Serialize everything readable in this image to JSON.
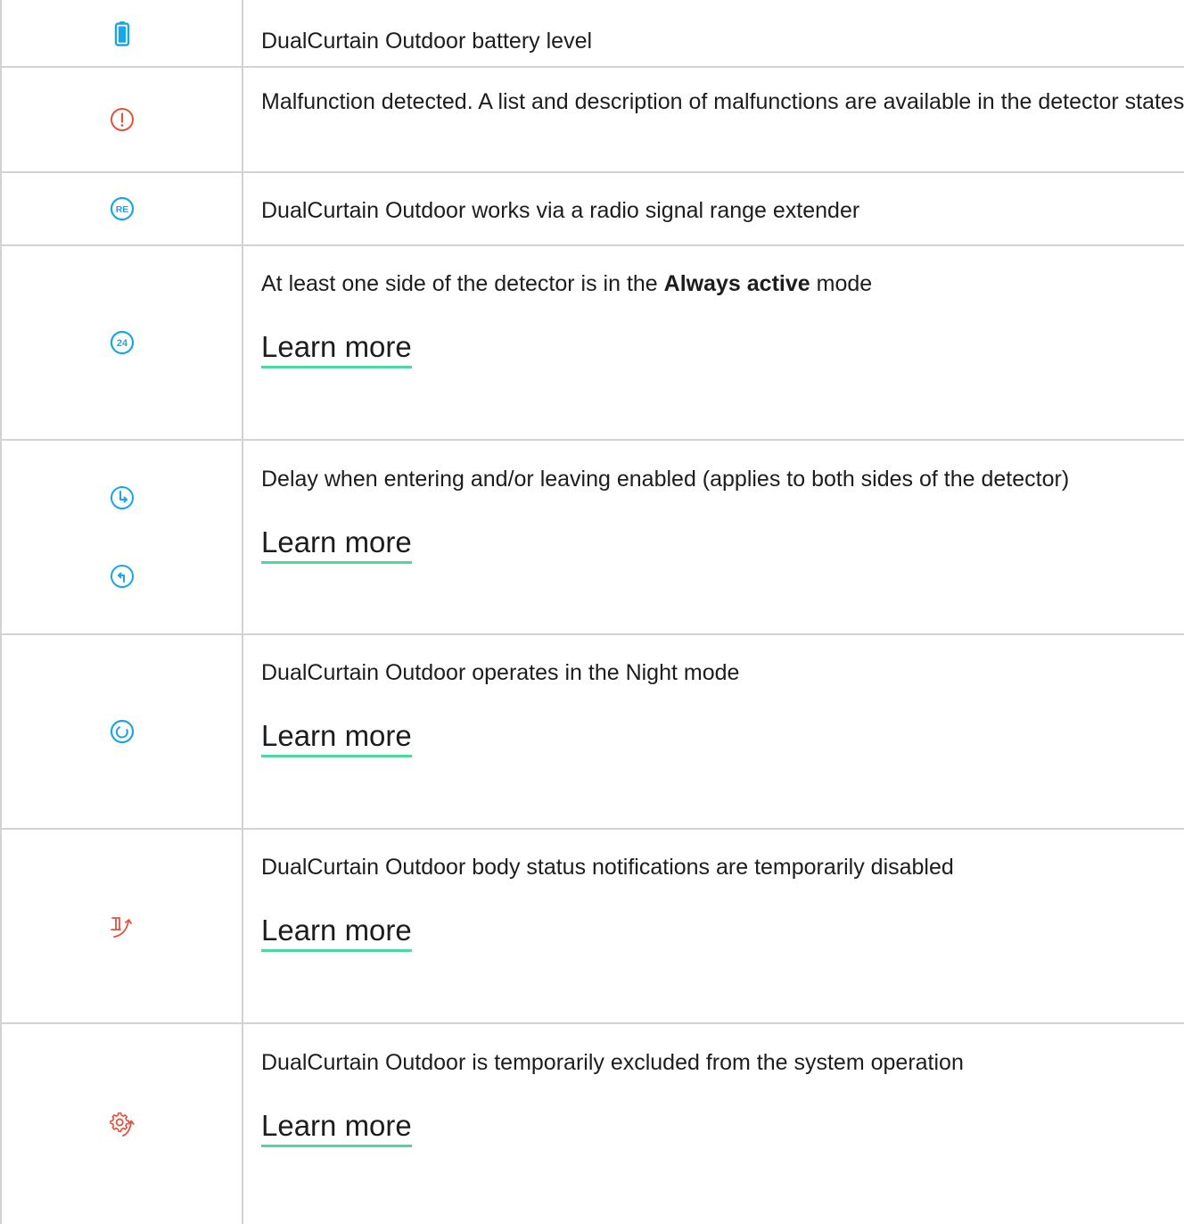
{
  "colors": {
    "accent_blue": "#1aa5e6",
    "alert_red": "#e2523f",
    "link_underline": "#4fd7a0",
    "border": "#d2d2d2"
  },
  "rows": [
    {
      "icons": [
        "battery-icon"
      ],
      "description": "DualCurtain Outdoor battery level"
    },
    {
      "icons": [
        "malfunction-icon"
      ],
      "description": "Malfunction detected. A list and description of malfunctions are available in the detector states"
    },
    {
      "icons": [
        "range-extender-icon"
      ],
      "icon_text": "RE",
      "description": "DualCurtain Outdoor works via a radio signal range extender"
    },
    {
      "icons": [
        "always-active-icon"
      ],
      "icon_text": "24",
      "description_before": "At least one side of the detector is in the ",
      "description_bold": "Always active",
      "description_after": " mode",
      "link": "Learn more"
    },
    {
      "icons": [
        "entry-delay-icon",
        "exit-delay-icon"
      ],
      "description": "Delay when entering and/or leaving enabled (applies to both sides of the detector)",
      "link": "Learn more"
    },
    {
      "icons": [
        "night-mode-icon"
      ],
      "description": "DualCurtain Outdoor operates in the Night mode",
      "link": "Learn more"
    },
    {
      "icons": [
        "body-notifications-disabled-icon"
      ],
      "description": "DualCurtain Outdoor body status notifications are temporarily disabled",
      "link": "Learn more"
    },
    {
      "icons": [
        "temporarily-excluded-icon"
      ],
      "description": "DualCurtain Outdoor is temporarily excluded from the system operation",
      "link": "Learn more"
    }
  ]
}
